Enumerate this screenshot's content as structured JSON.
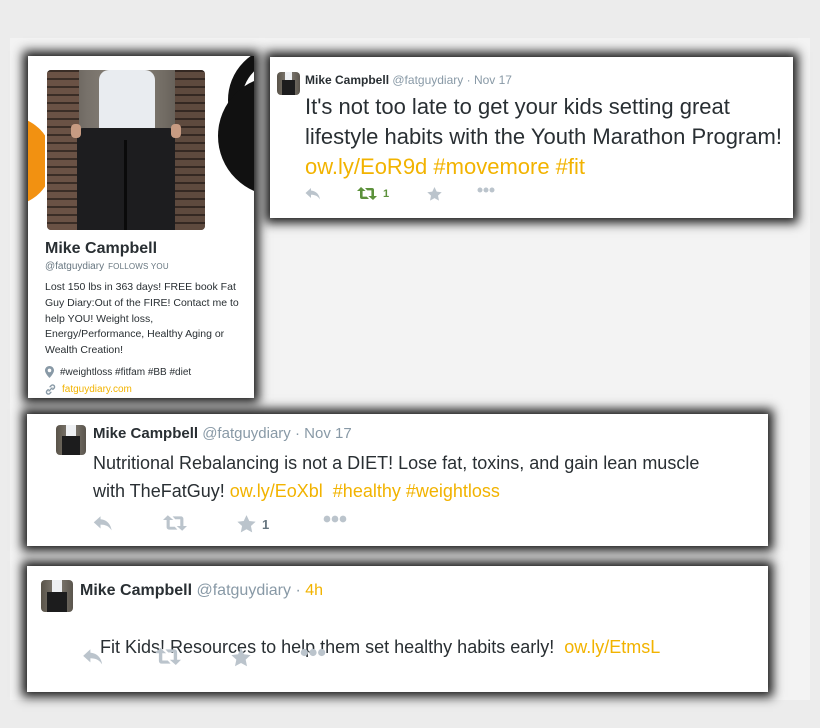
{
  "profile": {
    "name": "Mike Campbell",
    "handle": "@fatguydiary",
    "follows_you": "FOLLOWS YOU",
    "bio": "Lost 150 lbs in 363 days! FREE book Fat Guy Diary:Out of the FIRE! Contact me to help YOU! Weight loss, Energy/Performance, Healthy Aging or Wealth Creation!",
    "location": "#weightloss #fitfam #BB #diet",
    "url": "fatguydiary.com",
    "location_icon": "map-pin-icon",
    "url_icon": "link-icon"
  },
  "tweets": [
    {
      "name": "Mike Campbell",
      "handle": "@fatguydiary",
      "sep": "·",
      "time": "Nov 17",
      "text": "It's not too late to get your kids setting great lifestyle habits with the Youth Marathon Program! ",
      "link": "ow.ly/EoR9d",
      "hashtags": " #movemore #fit",
      "retweets": "1",
      "favorites": ""
    },
    {
      "name": "Mike Campbell",
      "handle": "@fatguydiary",
      "sep": "·",
      "time": "Nov 17",
      "text": "Nutritional Rebalancing is not a DIET! Lose fat, toxins, and gain lean muscle with TheFatGuy! ",
      "link": "ow.ly/EoXbl",
      "hashtags": "  #healthy #weightloss",
      "retweets": "",
      "favorites": "1"
    },
    {
      "name": "Mike Campbell",
      "handle": "@fatguydiary",
      "sep": "·",
      "time": "4h",
      "text": "Fit Kids! Resources to help them set healthy habits early!  ",
      "link": "ow.ly/EtmsL",
      "hashtags": "",
      "retweets": "",
      "favorites": ""
    }
  ],
  "colors": {
    "link": "#f2b300",
    "text": "#292f33",
    "muted": "#8899a6",
    "retweet_active": "#5c913b"
  },
  "icons": [
    "reply-icon",
    "retweet-icon",
    "favorite-icon",
    "more-icon"
  ]
}
